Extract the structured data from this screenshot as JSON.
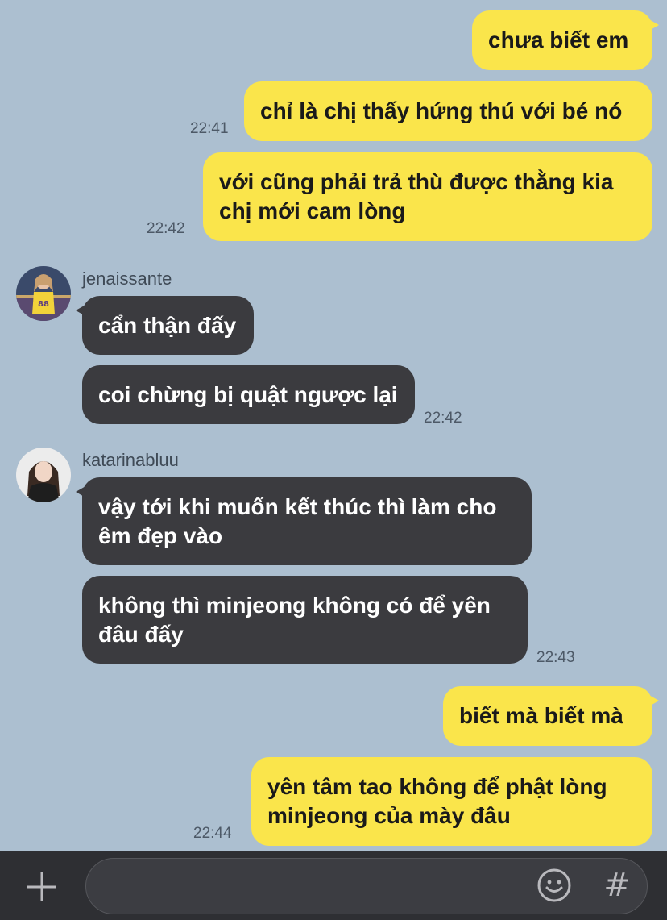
{
  "messages": [
    {
      "text": "chưa biết em"
    },
    {
      "text": "chỉ là chị thấy hứng thú với bé nó",
      "time": "22:41"
    },
    {
      "text": "với cũng phải trả thù được thằng kia\nchị mới cam lòng",
      "time": "22:42"
    },
    {
      "sender": "jenaissante",
      "text": "cẩn thận đấy"
    },
    {
      "text": "coi chừng bị quật ngược lại",
      "time": "22:42"
    },
    {
      "sender": "katarinabluu",
      "text": "vậy tới khi muốn kết thúc thì làm cho\nêm đẹp vào"
    },
    {
      "text": "không thì minjeong không có để yên\nđâu đấy",
      "time": "22:43"
    },
    {
      "text": "biết mà biết mà"
    },
    {
      "text": "yên tâm tao không để phật lòng\nminjeong của mày đâu",
      "time": "22:44"
    }
  ],
  "colors": {
    "background": "#acbfd0",
    "outgoing_bubble": "#fae54b",
    "incoming_bubble": "#3b3b3f",
    "bottom_bar": "#2e2f33"
  },
  "bottom_bar": {
    "icons": [
      "plus-icon",
      "emoji-icon",
      "hash-icon"
    ],
    "hash_label": "#"
  }
}
